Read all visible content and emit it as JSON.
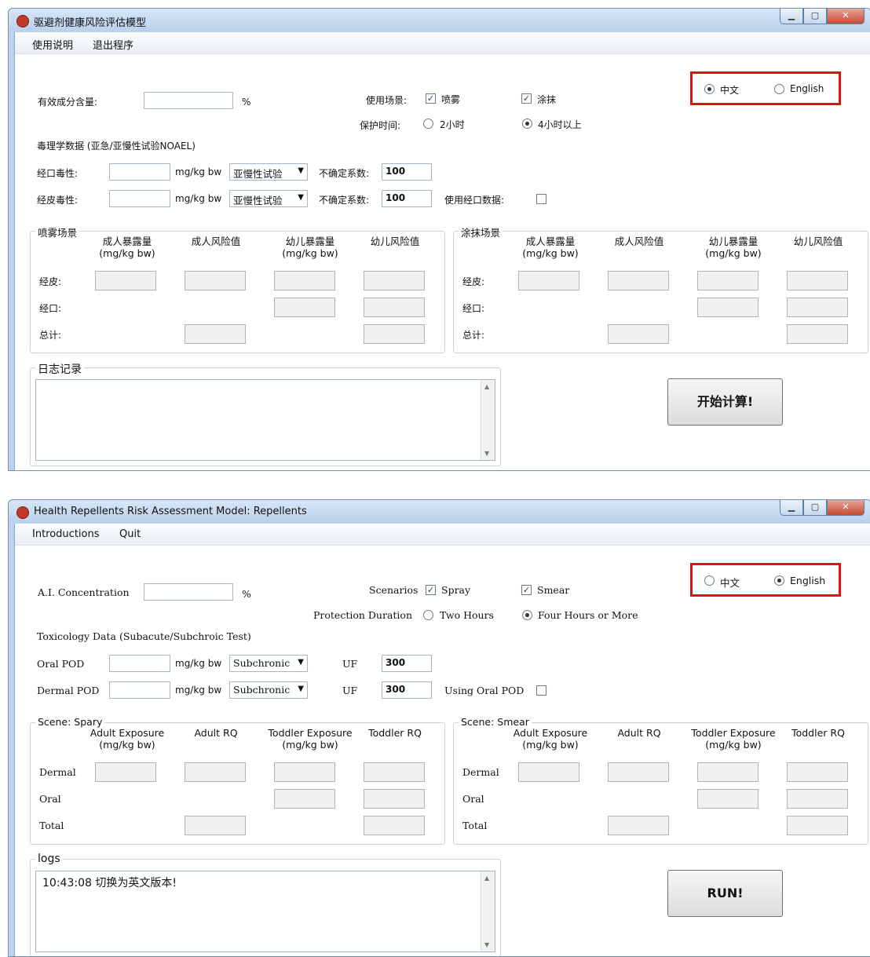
{
  "zh": {
    "title": "驱避剂健康风险评估模型",
    "menu": [
      "使用说明",
      "退出程序"
    ],
    "lang_zh": "中文",
    "lang_en": "English",
    "lang_selected": "zh",
    "ai_label": "有效成分含量:",
    "percent": "%",
    "scenario_label": "使用场景:",
    "spray": "喷雾",
    "smear": "涂抹",
    "duration_label": "保护时间:",
    "two_hours": "2小时",
    "four_hours": "4小时以上",
    "duration_selected": "four",
    "tox_title": "毒理学数据 (亚急/亚慢性试验NOAEL)",
    "oral_label": "经口毒性:",
    "dermal_label": "经皮毒性:",
    "unit": "mg/kg bw",
    "combo_value": "亚慢性试验",
    "uf_label": "不确定系数:",
    "uf_oral": "100",
    "uf_dermal": "100",
    "use_oral_label": "使用经口数据:",
    "spray_group": "喷雾场景",
    "smear_group": "涂抹场景",
    "col_adult_exp": "成人暴露量",
    "col_unit": "(mg/kg bw)",
    "col_adult_rq": "成人风险值",
    "col_toddler_exp": "幼儿暴露量",
    "col_toddler_rq": "幼儿风险值",
    "row_dermal": "经皮:",
    "row_oral": "经口:",
    "row_total": "总计:",
    "log_title": "日志记录",
    "log_text": "",
    "run": "开始计算!"
  },
  "en": {
    "title": "Health Repellents Risk Assessment Model:  Repellents",
    "menu": [
      "Introductions",
      "Quit"
    ],
    "lang_zh": "中文",
    "lang_en": "English",
    "lang_selected": "en",
    "ai_label": "A.I. Concentration",
    "percent": "%",
    "scenario_label": "Scenarios",
    "spray": "Spray",
    "smear": "Smear",
    "duration_label": "Protection Duration",
    "two_hours": "Two Hours",
    "four_hours": "Four Hours or More",
    "duration_selected": "four",
    "tox_title": "Toxicology Data (Subacute/Subchroic Test)",
    "oral_label": "Oral POD",
    "dermal_label": "Dermal POD",
    "unit": "mg/kg bw",
    "combo_value": "Subchronic",
    "uf_label": "UF",
    "uf_oral": "300",
    "uf_dermal": "300",
    "use_oral_label": "Using Oral POD",
    "spray_group": "Scene: Spary",
    "smear_group": "Scene: Smear",
    "col_adult_exp": "Adult Exposure",
    "col_unit": "(mg/kg bw)",
    "col_adult_rq": "Adult RQ",
    "col_toddler_exp": "Toddler Exposure",
    "col_toddler_rq": "Toddler RQ",
    "row_dermal": "Dermal",
    "row_oral": "Oral",
    "row_total": "Total",
    "log_title": "logs",
    "log_text": "10:43:08 切换为英文版本!",
    "run": "RUN!"
  },
  "window_controls": [
    "minimize-icon",
    "maximize-icon",
    "close-icon"
  ],
  "colors": {
    "highlight": "#e01010",
    "titlebar": "#c8dcf1"
  }
}
